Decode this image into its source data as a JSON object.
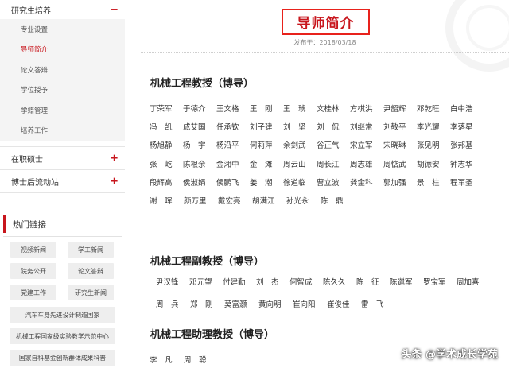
{
  "sidebar": {
    "section1": {
      "label": "研究生培养",
      "sign": "−"
    },
    "sub_items": [
      "专业设置",
      "导师简介",
      "论文答辩",
      "学位授予",
      "学籍管理",
      "培养工作"
    ],
    "section2": {
      "label": "在职硕士",
      "sign": "+"
    },
    "section3": {
      "label": "博士后流动站",
      "sign": "+"
    },
    "hot_links_title": "热门链接",
    "hot_buttons": [
      "视频新闻",
      "学工新闻",
      "院务公开",
      "论文答辩",
      "党建工作",
      "研究生新闻"
    ],
    "wide_buttons": [
      "汽车车身先进设计制造国家",
      "机械工程国家级实验教学示范中心",
      "国家自科基金创新群体成果科普"
    ]
  },
  "main": {
    "title": "导师简介",
    "pub_label": "发布于：",
    "pub_date": "2018/03/18",
    "group1": {
      "heading": "机械工程教授（博导）",
      "rows": [
        [
          "丁荣军",
          "于德介",
          "王文格",
          "王　刚",
          "王　琥",
          "文桂林",
          "方棋洪",
          "尹韶辉",
          "邓乾旺",
          "白中浩"
        ],
        [
          "冯　凯",
          "成艾国",
          "任承钦",
          "刘子建",
          "刘　坚",
          "刘　侃",
          "刘继常",
          "刘敬平",
          "李光耀",
          "李落星"
        ],
        [
          "杨旭静",
          "杨　宇",
          "杨沿平",
          "何莉萍",
          "余剑武",
          "谷正气",
          "宋立军",
          "宋晓琳",
          "张见明",
          "张邦基"
        ],
        [
          "张　屹",
          "陈根余",
          "金湘中",
          "金　滩",
          "周云山",
          "周长江",
          "周志雄",
          "周惦武",
          "胡德安",
          "钟志华"
        ],
        [
          "段辉高",
          "侯淑娟",
          "侯鹏飞",
          "姜　潮",
          "徐道临",
          "曹立波",
          "龚金科",
          "郭加强",
          "景　柱",
          "程军圣"
        ],
        [
          "谢　晖",
          "颜万里",
          "戴宏亮",
          "胡满江",
          "孙光永",
          "陈　鼎"
        ]
      ]
    },
    "group2": {
      "heading": "机械工程副教授（博导）",
      "rows": [
        [
          "尹汉锋",
          "邓元望",
          "付建勤",
          "刘　杰",
          "何智成",
          "陈久久",
          "陈　征",
          "陈邋军",
          "罗宝军",
          "周加喜"
        ],
        [
          "周　兵",
          "郑　刚",
          "莫富灏",
          "黄向明",
          "崔向阳",
          "崔俊佳",
          "雷　飞"
        ]
      ]
    },
    "group3": {
      "heading": "机械工程助理教授（博导）",
      "rows": [
        [
          "李　凡",
          "周　聪"
        ]
      ]
    }
  },
  "watermark": "头条 @学术成长学苑"
}
